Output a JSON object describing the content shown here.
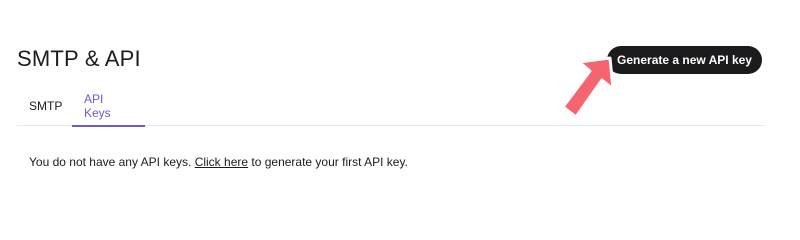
{
  "header": {
    "title": "SMTP & API",
    "generate_button_label": "Generate a new API key"
  },
  "tabs": [
    {
      "label": "SMTP",
      "active": false
    },
    {
      "label": "API Keys",
      "active": true
    }
  ],
  "empty_state": {
    "text_before": "You do not have any API keys. ",
    "link_text": "Click here",
    "text_after": " to generate your first API key."
  },
  "colors": {
    "accent": "#6d5bd0",
    "button_bg": "#1b1b1d",
    "annotation_arrow": "#f5656f"
  },
  "icons": {
    "annotation": "arrow-pointer-icon"
  }
}
